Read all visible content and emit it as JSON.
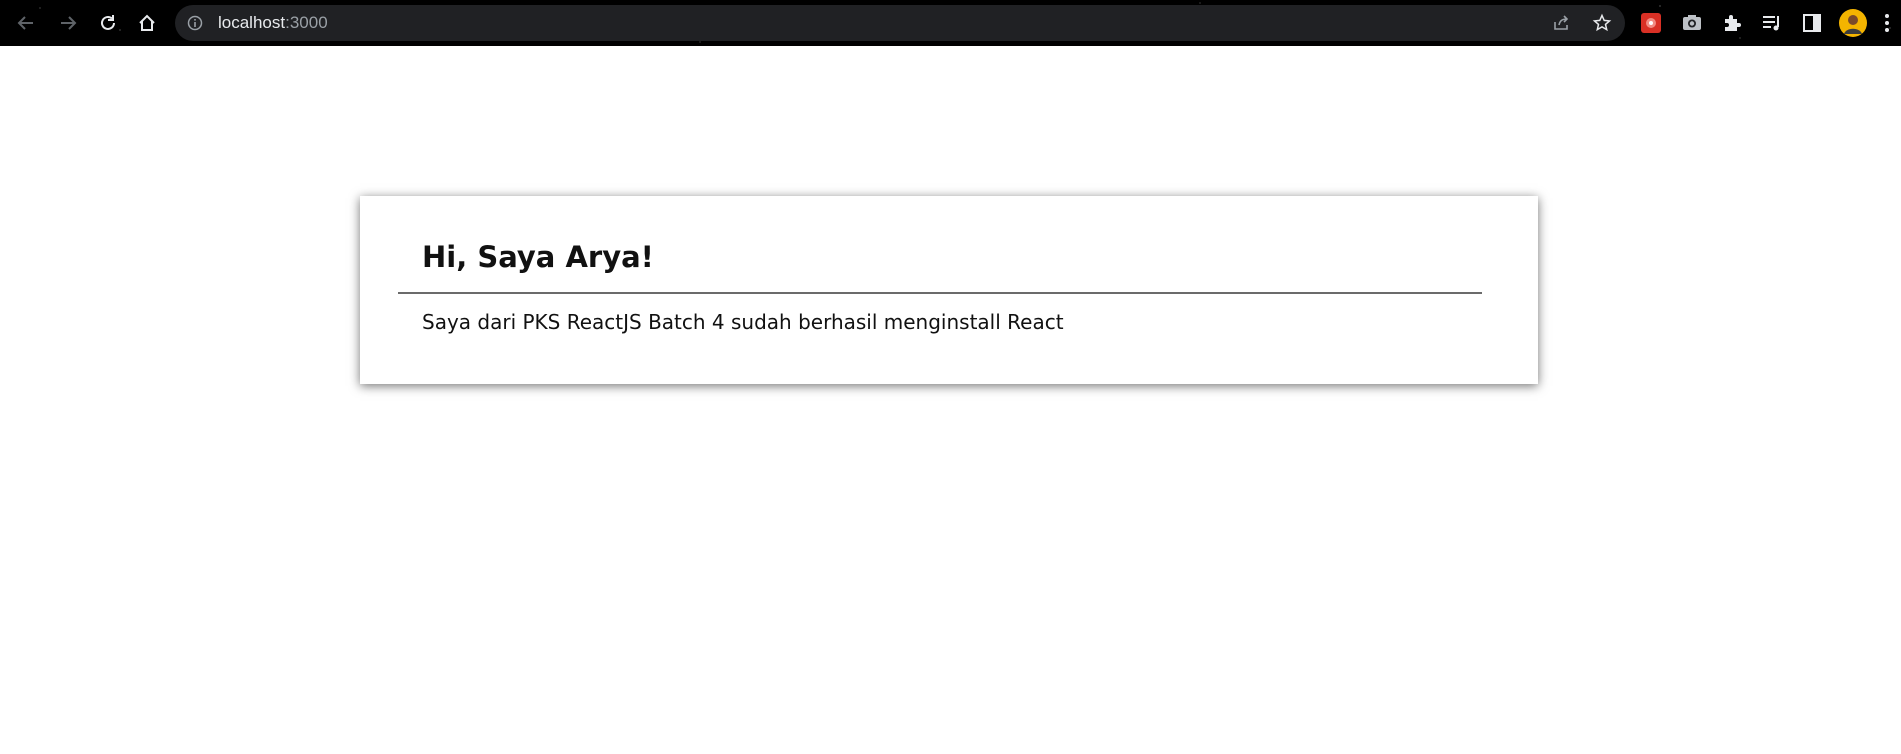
{
  "browser": {
    "url_host": "localhost",
    "url_port": ":3000",
    "nav": {
      "back_icon": "arrow-left-icon",
      "forward_icon": "arrow-right-icon",
      "reload_icon": "reload-icon",
      "home_icon": "home-icon"
    },
    "omnibox_icons": [
      "info-icon",
      "share-icon",
      "star-icon"
    ],
    "toolbar_icons": [
      "extension-red-icon",
      "camera-icon",
      "puzzle-icon",
      "media-list-icon",
      "side-panel-icon",
      "profile-avatar",
      "kebab-menu-icon"
    ]
  },
  "page": {
    "heading": "Hi, Saya Arya!",
    "body": "Saya dari PKS ReactJS Batch 4 sudah berhasil menginstall React"
  },
  "colors": {
    "toolbar_bg": "#000000",
    "omnibox_bg": "#202124",
    "url_text": "#e8eaed",
    "url_port": "#9aa0a6",
    "page_bg": "#ffffff",
    "text": "#111111"
  }
}
